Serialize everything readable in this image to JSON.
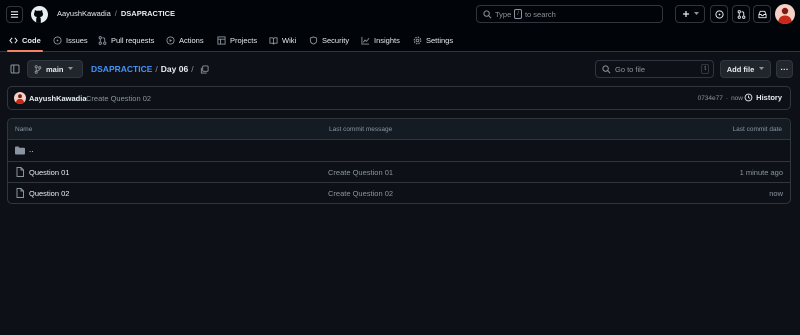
{
  "header": {
    "owner": "AayushKawadia",
    "separator": "/",
    "repo": "DSAPRACTICE",
    "search_before": "Type",
    "search_key": "/",
    "search_after": "to search"
  },
  "tabs": [
    {
      "label": "Code",
      "icon": "code-icon"
    },
    {
      "label": "Issues",
      "icon": "issue-icon"
    },
    {
      "label": "Pull requests",
      "icon": "pull-request-icon"
    },
    {
      "label": "Actions",
      "icon": "play-icon"
    },
    {
      "label": "Projects",
      "icon": "table-icon"
    },
    {
      "label": "Wiki",
      "icon": "book-icon"
    },
    {
      "label": "Security",
      "icon": "shield-icon"
    },
    {
      "label": "Insights",
      "icon": "graph-icon"
    },
    {
      "label": "Settings",
      "icon": "gear-icon"
    }
  ],
  "toolbar": {
    "branch": "main",
    "path_repo": "DSAPRACTICE",
    "path_sep1": "/",
    "path_folder": "Day 06",
    "path_sep2": "/",
    "goto_placeholder": "Go to file",
    "goto_key": "t",
    "add_file": "Add file",
    "more": "···"
  },
  "commit": {
    "author": "AayushKawadia",
    "message": "Create Question 02",
    "hash": "0734e77",
    "dot": "·",
    "time": "now",
    "history": "History"
  },
  "table": {
    "headers": {
      "name": "Name",
      "message": "Last commit message",
      "date": "Last commit date"
    },
    "parent": "..",
    "rows": [
      {
        "name": "Question 01",
        "message": "Create Question 01",
        "date": "1 minute ago"
      },
      {
        "name": "Question 02",
        "message": "Create Question 02",
        "date": "now"
      }
    ]
  },
  "colors": {
    "background": "#0d1117",
    "header": "#010409",
    "border": "#30363d",
    "link": "#4493f8",
    "muted": "#8b949e",
    "active_tab": "#f78166"
  }
}
